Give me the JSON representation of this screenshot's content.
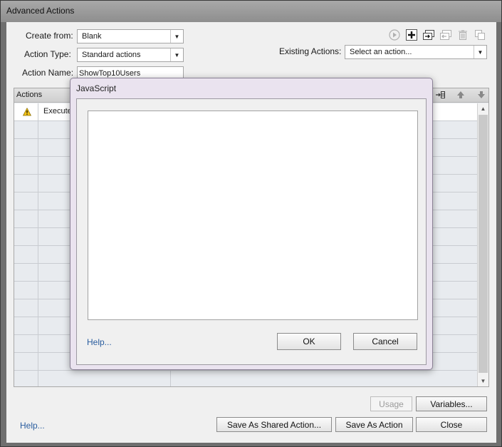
{
  "window": {
    "title": "Advanced Actions"
  },
  "form": {
    "create_from_label": "Create from:",
    "create_from_value": "Blank",
    "action_type_label": "Action Type:",
    "action_type_value": "Standard actions",
    "action_name_label": "Action Name:",
    "action_name_value": "ShowTop10Users",
    "existing_actions_label": "Existing Actions:",
    "existing_actions_value": "Select an action..."
  },
  "toolbar": [
    "preview-icon",
    "add-icon",
    "insert-icon",
    "remove-icon",
    "delete-icon",
    "duplicate-icon"
  ],
  "actions_grid": {
    "header": "Actions",
    "rows": [
      {
        "status": "warning-icon",
        "action": "Execute"
      }
    ]
  },
  "buttons": {
    "usage": "Usage",
    "variables": "Variables...",
    "help": "Help...",
    "save_shared": "Save As Shared Action...",
    "save_action": "Save As Action",
    "close": "Close"
  },
  "modal": {
    "title": "JavaScript",
    "script_value": "",
    "help": "Help...",
    "ok": "OK",
    "cancel": "Cancel"
  }
}
